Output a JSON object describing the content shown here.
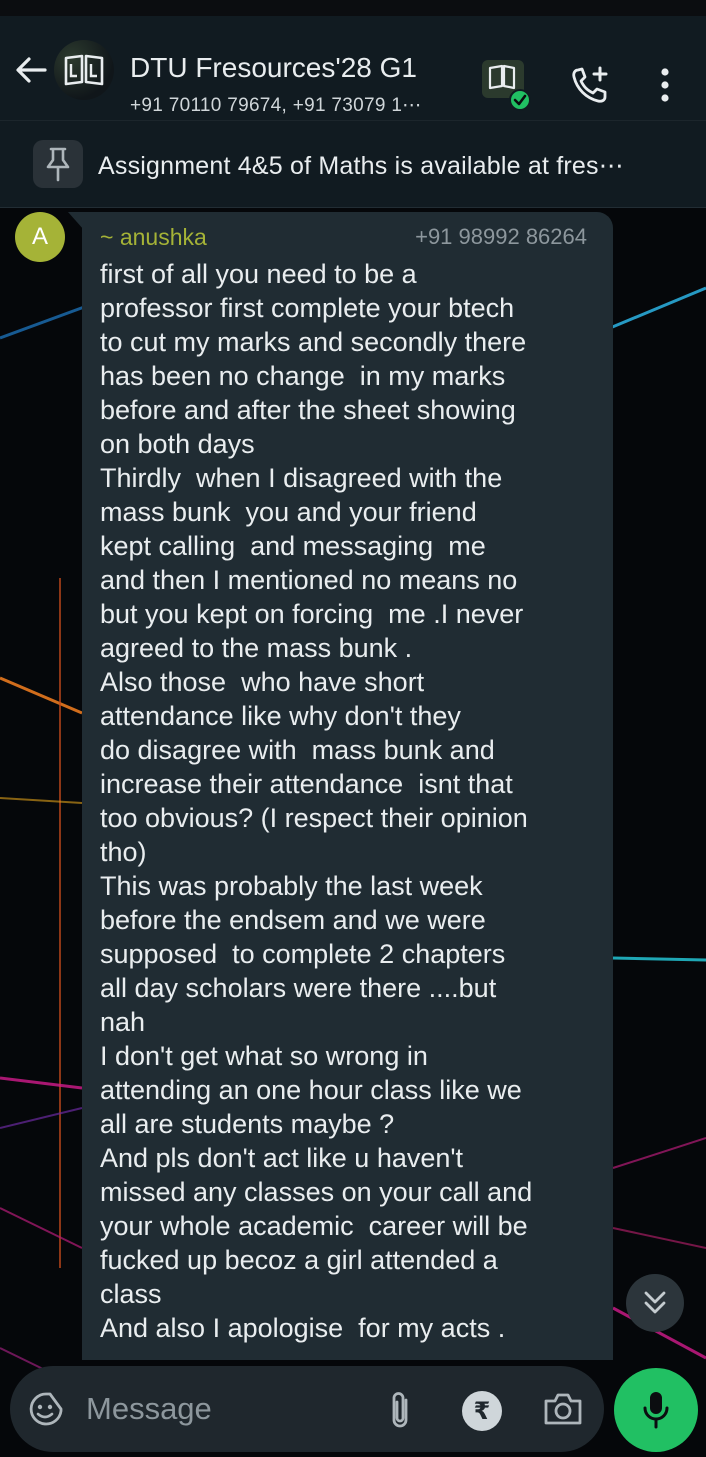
{
  "header": {
    "title": "DTU Fresources'28 G1",
    "members": "+91 70110 79674, +91 73079 1⋯"
  },
  "pinned": {
    "text": "Assignment 4&5 of Maths is available at fres⋯"
  },
  "message": {
    "avatar_letter": "A",
    "sender_name": "~ anushka",
    "sender_phone": "+91 98992 86264",
    "lines": [
      "first of all you need to be a",
      "professor first complete your btech",
      "to cut my marks and secondly there",
      "has been no change  in my marks",
      "before and after the sheet showing",
      "on both days",
      "Thirdly  when I disagreed with the",
      "mass bunk  you and your friend",
      "kept calling  and messaging  me",
      "and then I mentioned no means no",
      "but you kept on forcing  me .I never",
      "agreed to the mass bunk .",
      "Also those  who have short",
      "attendance like why don't they",
      "do disagree with  mass bunk and",
      "increase their attendance  isnt that",
      "too obvious? (I respect their opinion",
      "tho)",
      "This was probably the last week",
      "before the endsem and we were",
      "supposed  to complete 2 chapters",
      "all day scholars were there ....but",
      "nah",
      "I don't get what so wrong in",
      "attending an one hour class like we",
      "all are students maybe ?",
      "And pls don't act like u haven't",
      "missed any classes on your call and",
      "your whole academic  career will be",
      "fucked up becoz a girl attended a",
      "class",
      "And also I apologise  for my acts ."
    ]
  },
  "composer": {
    "placeholder": "Message",
    "rupee_symbol": "₹"
  },
  "colors": {
    "header_bg": "#111b21",
    "bubble_bg": "#202c33",
    "sender_name": "#a5b337",
    "mic_green": "#21c063"
  },
  "icons": [
    "back-arrow-icon",
    "group-avatar-icon",
    "community-icon",
    "add-call-icon",
    "more-vert-icon",
    "pin-icon",
    "double-chevron-down-icon",
    "emoji-sticker-icon",
    "attach-icon",
    "rupee-icon",
    "camera-icon",
    "mic-icon"
  ]
}
